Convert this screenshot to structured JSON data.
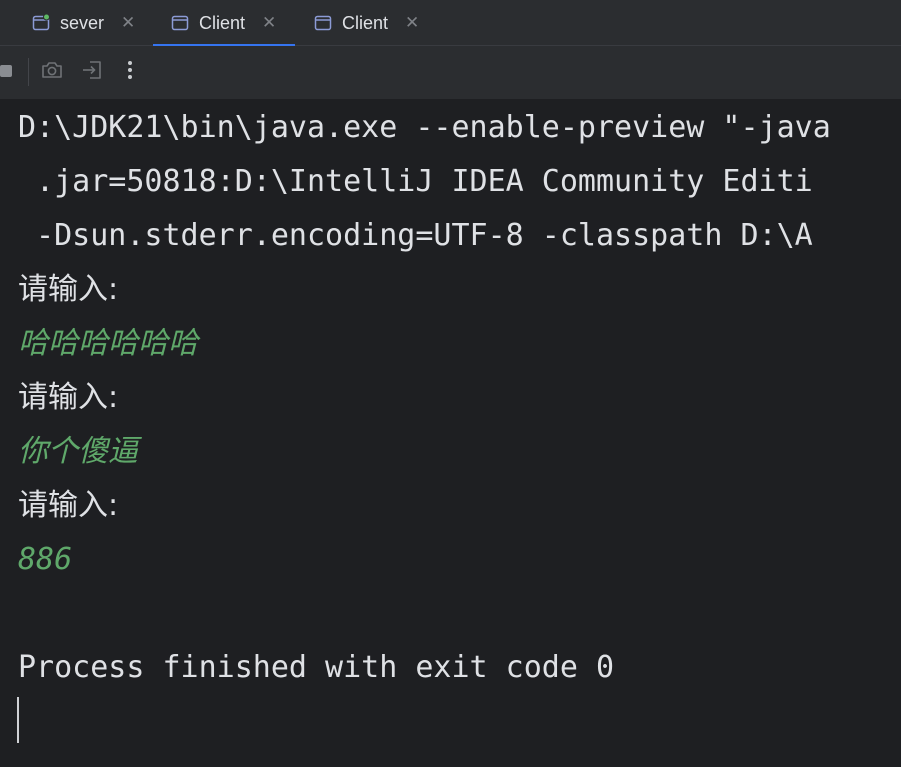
{
  "tabs": [
    {
      "label": "sever",
      "icon": "run-config-icon",
      "active": false,
      "status": "running"
    },
    {
      "label": "Client",
      "icon": "run-config-icon",
      "active": true
    },
    {
      "label": "Client",
      "icon": "run-config-icon",
      "active": false
    }
  ],
  "toolbar": {
    "buttons": [
      "stop-icon",
      "camera-icon",
      "exit-icon",
      "more-vertical-icon"
    ]
  },
  "console": {
    "lines": [
      "D:\\JDK21\\bin\\java.exe --enable-preview \"-java",
      " .jar=50818:D:\\IntelliJ IDEA Community Editi",
      " -Dsun.stderr.encoding=UTF-8 -classpath D:\\A",
      "请输入:",
      "哈哈哈哈哈哈",
      "请输入:",
      "你个傻逼",
      "请输入:",
      "886",
      "",
      "Process finished with exit code 0"
    ]
  },
  "colors": {
    "background": "#1e1f22",
    "panel": "#2b2d30",
    "text": "#dfe1e5",
    "user_input": "#5fa86a",
    "accent": "#3574f0",
    "running_indicator": "#5fb865"
  }
}
